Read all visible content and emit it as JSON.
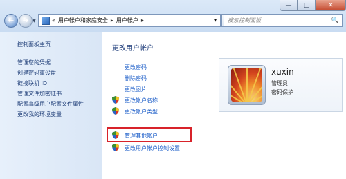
{
  "window": {
    "controls": {
      "minimize": "—",
      "maximize": "□",
      "close": "✕"
    }
  },
  "nav": {
    "back_icon": "←",
    "forward_icon": "→",
    "history_icon": "▼",
    "breadcrumb": {
      "overflow": "«",
      "items": [
        "用户帐户和家庭安全",
        "用户帐户"
      ],
      "separator": "▸"
    },
    "refresh_icon": "↻",
    "search_placeholder": "搜索控制面板",
    "search_icon": "🔍"
  },
  "sidebar": {
    "home": "控制面板主页",
    "links": [
      "管理您的凭据",
      "创建密码重设盘",
      "链接联机 ID",
      "管理文件加密证书",
      "配置高级用户配置文件属性",
      "更改我的环境变量"
    ]
  },
  "main": {
    "title": "更改用户帐户",
    "tasks": [
      {
        "label": "更改密码",
        "shield": false
      },
      {
        "label": "删除密码",
        "shield": false
      },
      {
        "label": "更改图片",
        "shield": false
      },
      {
        "label": "更改帐户名称",
        "shield": true
      },
      {
        "label": "更改帐户类型",
        "shield": true
      }
    ],
    "tasks2": [
      {
        "label": "管理其他帐户",
        "shield": true
      },
      {
        "label": "更改用户帐户控制设置",
        "shield": true
      }
    ]
  },
  "user": {
    "name": "xuxin",
    "role": "管理员",
    "protection": "密码保护"
  },
  "colors": {
    "highlight": "#d8232a",
    "link": "#1a5cc8",
    "sidebar_link": "#1f3e78"
  }
}
